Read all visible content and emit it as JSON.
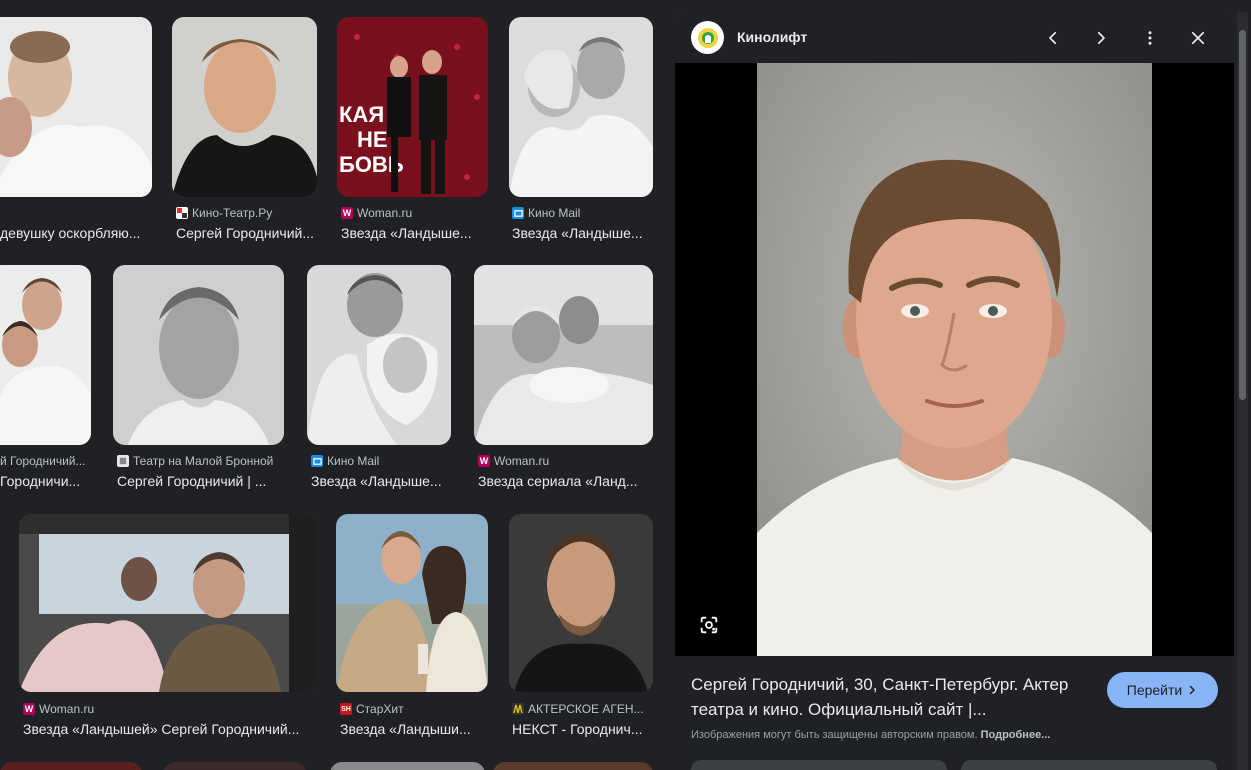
{
  "results": [
    {
      "source": "",
      "title": "девушку оскорбляю...",
      "favicon": ""
    },
    {
      "source": "Кино-Театр.Ру",
      "title": "Сергей Городничий...",
      "favicon": "kt"
    },
    {
      "source": "Woman.ru",
      "title": "Звезда «Ландыше...",
      "favicon": "W"
    },
    {
      "source": "Кино Mail",
      "title": "Звезда «Ландыше...",
      "favicon": "mail"
    },
    {
      "source": "й Городничий...",
      "title": "Городничи...",
      "favicon": "kt"
    },
    {
      "source": "Театр на Малой Бронной",
      "title": "Сергей Городничий | ...",
      "favicon": "teatr"
    },
    {
      "source": "Кино Mail",
      "title": "Звезда «Ландыше...",
      "favicon": "mail"
    },
    {
      "source": "Woman.ru",
      "title": "Звезда сериала «Ланд...",
      "favicon": "W"
    },
    {
      "source": "Woman.ru",
      "title": "Звезда «Ландышей» Сергей Городничий...",
      "favicon": "W"
    },
    {
      "source": "СтарХит",
      "title": "Звезда «Ландыши...",
      "favicon": "SH"
    },
    {
      "source": "АКТЕРСКОЕ АГЕН...",
      "title": "НЕКСТ - Городнич...",
      "favicon": "next"
    }
  ],
  "panel": {
    "site_name": "Кинолифт",
    "title": "Сергей Городничий, 30, Санкт-Петербург. Актер театра и кино. Официальный сайт |...",
    "visit_label": "Перейти",
    "copyright": "Изображения могут быть защищены авторским правом.",
    "more_link": "Подробнее..."
  },
  "colors": {
    "background": "#202124",
    "panel": "#303134",
    "accent": "#8ab4f8",
    "woman_favicon": "#b4005a",
    "mail_favicon": "#168de2"
  },
  "icons": {
    "prev": "chevron-left-icon",
    "next": "chevron-right-icon",
    "more": "more-vert-icon",
    "close": "close-icon",
    "lens": "lens-icon"
  }
}
